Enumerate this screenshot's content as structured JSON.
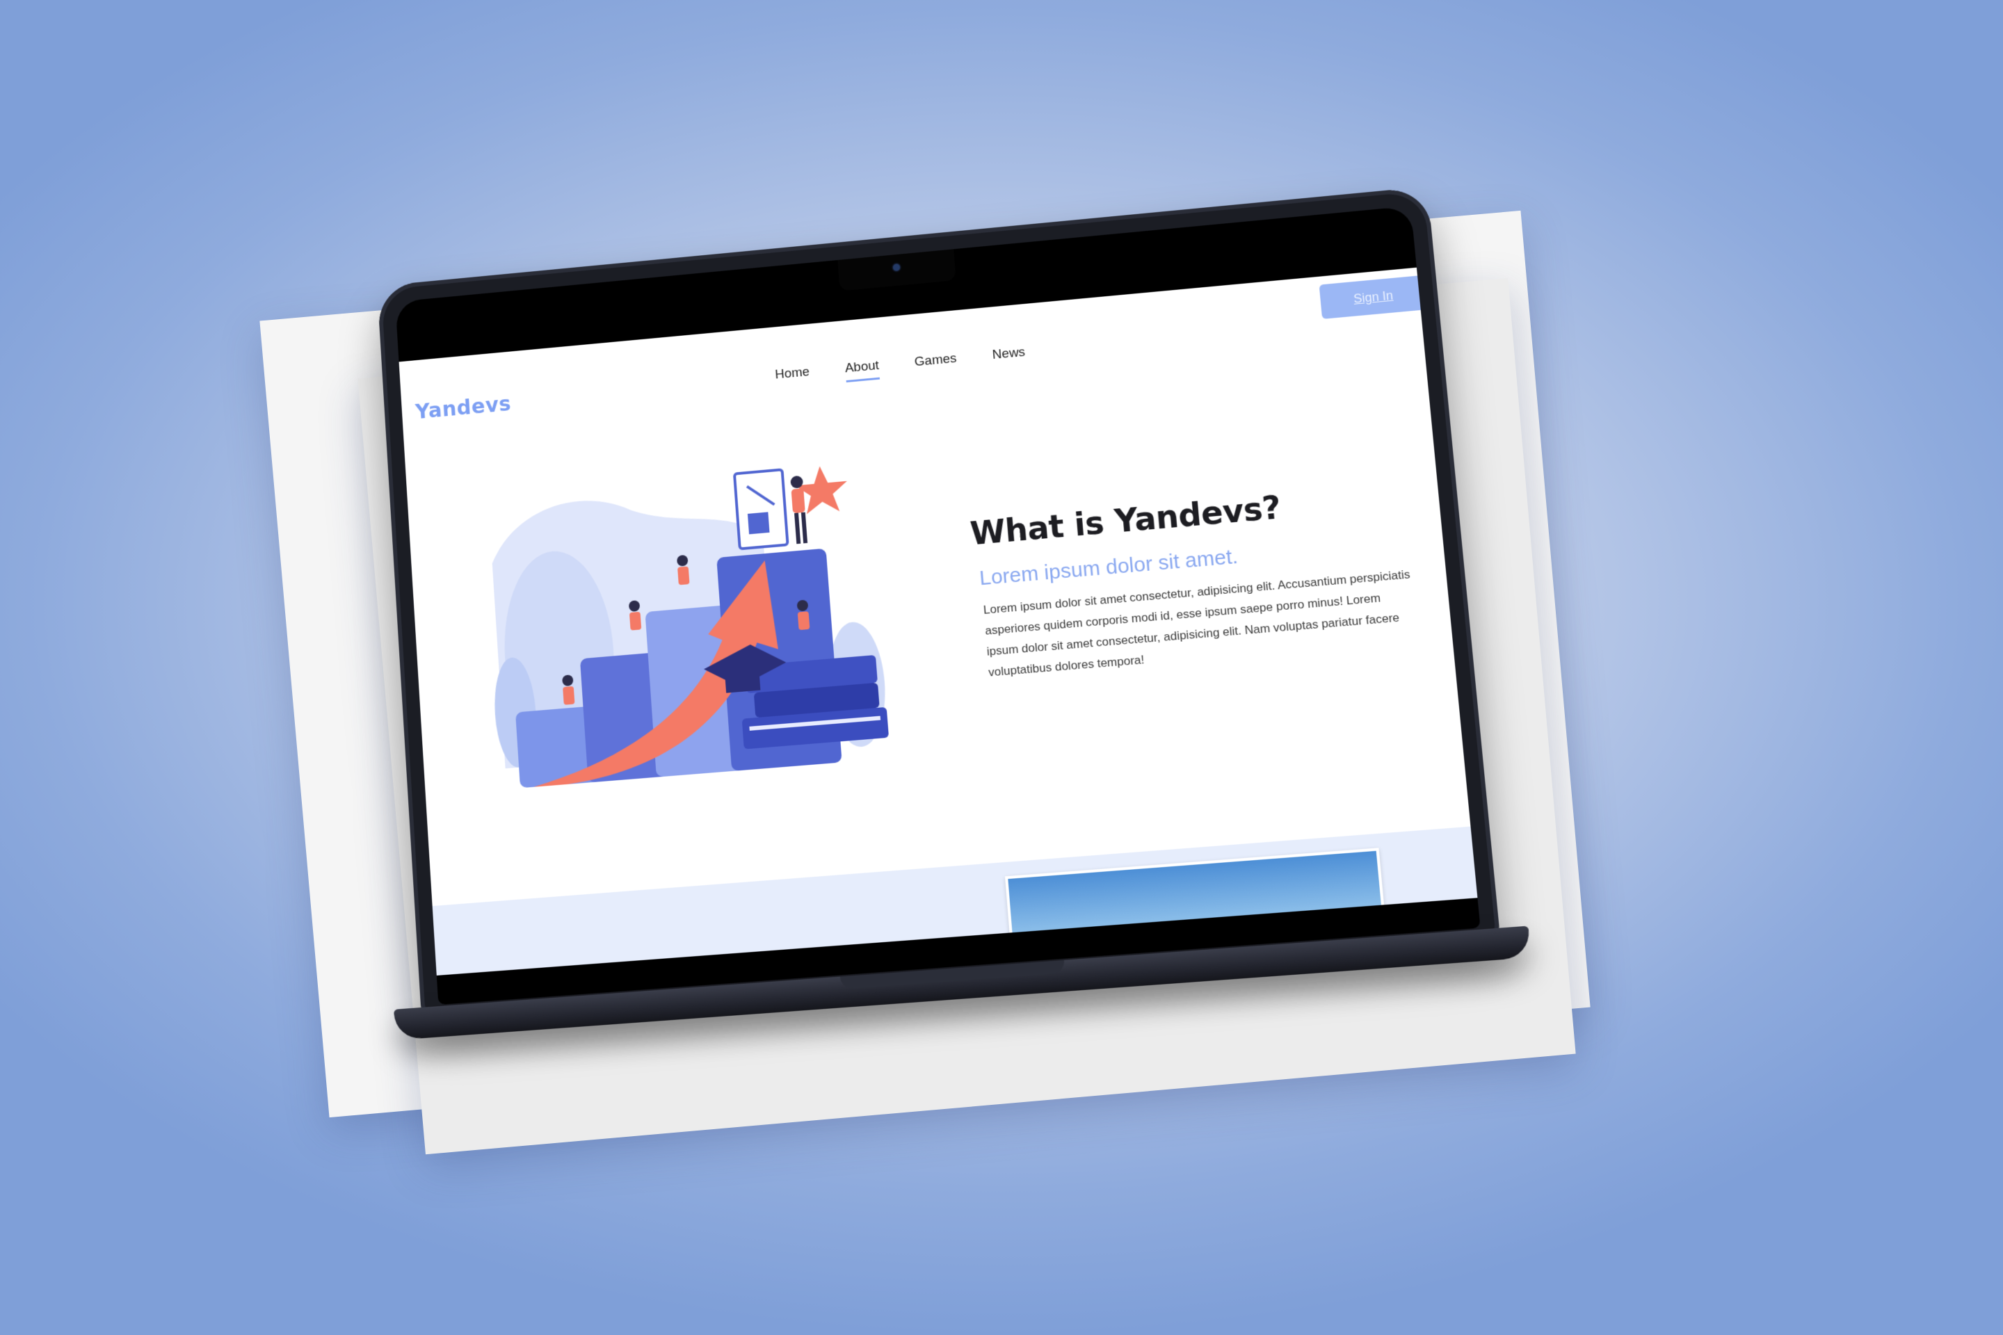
{
  "site": {
    "logo": "Yandevs",
    "nav": [
      "Home",
      "About",
      "Games",
      "News"
    ],
    "active_nav": "About",
    "signin_label": "Sign In"
  },
  "hero": {
    "title": "What is Yandevs?",
    "subtitle": "Lorem ipsum dolor sit amet.",
    "paragraph": "Lorem ipsum dolor sit amet consectetur, adipisicing elit. Accusantium perspiciatis asperiores quidem corporis modi id, esse ipsum saepe porro minus! Lorem ipsum dolor sit amet consectetur, adipisicing elit. Nam voluptas pariatur facere voluptatibus dolores tempora!"
  },
  "colors": {
    "brand": "#7d9ff3",
    "signin_bg": "#9bb7f5",
    "band_bg": "#e6edfc",
    "accent_arrow": "#f47a66"
  },
  "icons": {
    "illustration": "growth-arrow-illustration"
  }
}
